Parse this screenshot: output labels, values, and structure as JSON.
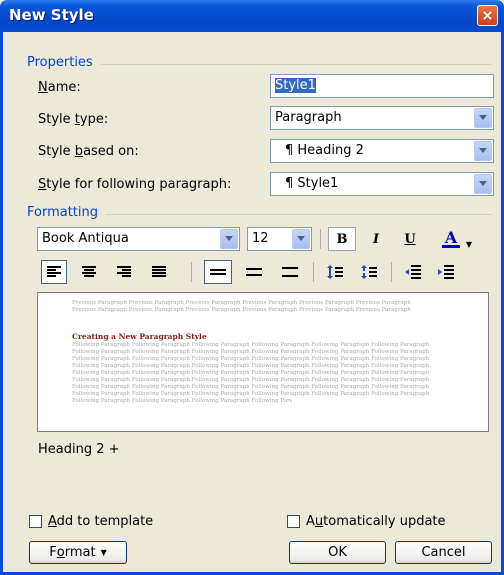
{
  "window": {
    "title": "New Style",
    "close_glyph": "×"
  },
  "properties": {
    "group_label": "Properties",
    "name_label": "Name:",
    "name_value": "Style1",
    "style_type_label": "Style type:",
    "style_type_value": "Paragraph",
    "based_on_label": "Style based on:",
    "based_on_value": "¶ Heading 2",
    "following_label": "Style for following paragraph:",
    "following_value": "¶ Style1"
  },
  "formatting": {
    "group_label": "Formatting",
    "font": "Book Antiqua",
    "size": "12",
    "bold_label": "B",
    "italic_label": "I",
    "underline_label": "U",
    "font_color_label": "A",
    "font_color": "#0000cc"
  },
  "preview": {
    "previous_text": "Previous Paragraph Previous Paragraph Previous Paragraph Previous Paragraph Previous Paragraph Previous Paragraph",
    "heading": "Creating a New Paragraph Style",
    "heading_color": "#8b1a1a",
    "following_text": "Following Paragraph Following Paragraph Following Paragraph Following Paragraph Following Paragraph Following Paragraph"
  },
  "description": "Heading 2 +",
  "footer": {
    "add_to_template": "Add to template",
    "auto_update": "Automatically update",
    "format_button": "Format",
    "ok_button": "OK",
    "cancel_button": "Cancel"
  }
}
